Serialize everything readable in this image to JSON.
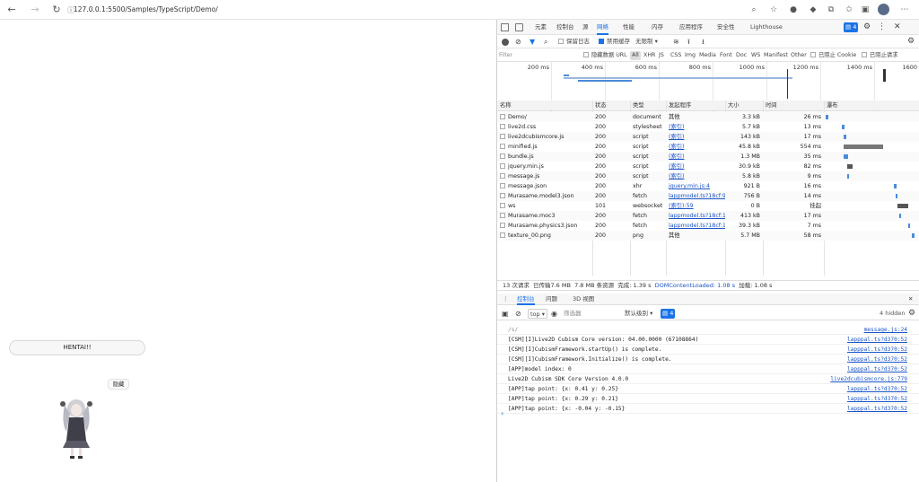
{
  "browser": {
    "url": "127.0.0.1:5500/Samples/TypeScript/Demo/"
  },
  "page": {
    "hentai_button": "HENTAI!!",
    "hide_button": "隐藏"
  },
  "devtools": {
    "tabs": [
      "元素",
      "控制台",
      "源",
      "网络",
      "性能",
      "内存",
      "应用程序",
      "安全性",
      "Lighthouse"
    ],
    "active_tab": "网络",
    "issue_count": "4",
    "toolbar": {
      "preserve_log": "保留日志",
      "disable_cache": "禁用缓存",
      "throttle": "无限制"
    },
    "filter": {
      "placeholder": "Filter",
      "hide_data_urls": "隐藏数据 URL",
      "types": [
        "All",
        "XHR",
        "JS",
        "CSS",
        "Img",
        "Media",
        "Font",
        "Doc",
        "WS",
        "Manifest",
        "Other"
      ],
      "blocked_cookies": "已阻止 Cookie",
      "blocked_requests": "已阻止请求"
    },
    "timeline_ticks": [
      "200 ms",
      "400 ms",
      "600 ms",
      "800 ms",
      "1000 ms",
      "1200 ms",
      "1400 ms",
      "1600"
    ],
    "columns": [
      "名称",
      "状态",
      "类型",
      "发起程序",
      "大小",
      "时间",
      "瀑布"
    ],
    "requests": [
      {
        "name": "Demo/",
        "status": "200",
        "type": "document",
        "initiator": "其他",
        "size": "3.3 kB",
        "time": "26 ms"
      },
      {
        "name": "live2d.css",
        "status": "200",
        "type": "stylesheet",
        "initiator": "(索引)",
        "size": "5.7 kB",
        "time": "13 ms"
      },
      {
        "name": "live2dcubismcore.js",
        "status": "200",
        "type": "script",
        "initiator": "(索引)",
        "size": "143 kB",
        "time": "17 ms"
      },
      {
        "name": "minified.js",
        "status": "200",
        "type": "script",
        "initiator": "(索引)",
        "size": "45.8 kB",
        "time": "554 ms"
      },
      {
        "name": "bundle.js",
        "status": "200",
        "type": "script",
        "initiator": "(索引)",
        "size": "1.3 MB",
        "time": "35 ms"
      },
      {
        "name": "jquery.min.js",
        "status": "200",
        "type": "script",
        "initiator": "(索引)",
        "size": "30.9 kB",
        "time": "82 ms"
      },
      {
        "name": "message.js",
        "status": "200",
        "type": "script",
        "initiator": "(索引)",
        "size": "5.8 kB",
        "time": "9 ms"
      },
      {
        "name": "message.json",
        "status": "200",
        "type": "xhr",
        "initiator": "jquery.min.js:4",
        "size": "921 B",
        "time": "16 ms"
      },
      {
        "name": "Murasame.model3.json",
        "status": "200",
        "type": "fetch",
        "initiator": "lappmodel.ts?18cf:90",
        "size": "756 B",
        "time": "14 ms"
      },
      {
        "name": "ws",
        "status": "101",
        "type": "websocket",
        "initiator": "(索引):59",
        "size": "0 B",
        "time": "挂起"
      },
      {
        "name": "Murasame.moc3",
        "status": "200",
        "type": "fetch",
        "initiator": "lappmodel.ts?18cf:1...",
        "size": "413 kB",
        "time": "17 ms"
      },
      {
        "name": "Murasame.physics3.json",
        "status": "200",
        "type": "fetch",
        "initiator": "lappmodel.ts?18cf:1...",
        "size": "39.3 kB",
        "time": "7 ms"
      },
      {
        "name": "texture_00.png",
        "status": "200",
        "type": "png",
        "initiator": "其他",
        "size": "5.7 MB",
        "time": "58 ms"
      }
    ],
    "status_bar": {
      "requests": "13 次请求",
      "transferred": "已传输7.6 MB",
      "resources": "7.8 MB 条资源",
      "finish": "完成: 1.39 s",
      "dom_loaded": "DOMContentLoaded: 1.08 s",
      "load": "加载: 1.08 s"
    },
    "drawer_tabs": [
      "控制台",
      "问题",
      "3D 视图"
    ],
    "console_toolbar": {
      "context": "top",
      "filter_placeholder": "筛选器",
      "levels": "默认级别",
      "issues": "4",
      "hidden": "4 hidden"
    },
    "console_lines": [
      {
        "msg": "/s/",
        "src": "message.js:24"
      },
      {
        "msg": "[CSM][I]Live2D Cubism Core version: 04.00.0000 (67108864)",
        "src": "lapppal.ts?d370:52"
      },
      {
        "msg": "[CSM][I]CubismFramework.startUp() is complete.",
        "src": "lapppal.ts?d370:52"
      },
      {
        "msg": "[CSM][I]CubismFramework.Initialize() is complete.",
        "src": "lapppal.ts?d370:52"
      },
      {
        "msg": "[APP]model index: 0",
        "src": "lapppal.ts?d370:52"
      },
      {
        "msg": "Live2D Cubism SDK Core Version 4.0.0",
        "src": "live2dcubismcore.js:779"
      },
      {
        "msg": "[APP]tap point: {x: 0.41 y: 0.25}",
        "src": "lapppal.ts?d370:52"
      },
      {
        "msg": "[APP]tap point: {x: 0.29 y: 0.21}",
        "src": "lapppal.ts?d370:52"
      },
      {
        "msg": "[APP]tap point: {x: -0.04 y: -0.15}",
        "src": "lapppal.ts?d370:52"
      }
    ]
  }
}
